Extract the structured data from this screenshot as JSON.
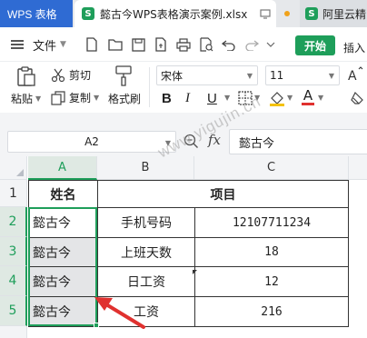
{
  "titlebar": {
    "app_tab": "WPS 表格",
    "doc_tab": "懿古今WPS表格演示案例.xlsx",
    "doc_tab_icon": "S",
    "second_tab": "阿里云精",
    "second_tab_icon": "S"
  },
  "menubar": {
    "file_label": "文件",
    "start_label": "开始",
    "insert_label": "插入"
  },
  "ribbon": {
    "paste_label": "粘贴",
    "cut_label": "剪切",
    "copy_label": "复制",
    "format_painter_label": "格式刷",
    "font_name": "宋体",
    "font_size": "11",
    "bold": "B",
    "italic": "I",
    "underline": "U",
    "font_color_letter": "A"
  },
  "formula_bar": {
    "name_box": "A2",
    "fx": "fx",
    "value": "懿古今"
  },
  "watermark": "www.yigujin.cn",
  "sheet": {
    "columns": [
      "A",
      "B",
      "C"
    ],
    "rows": [
      "1",
      "2",
      "3",
      "4",
      "5"
    ],
    "header": {
      "a": "姓名",
      "bc": "项目"
    },
    "data": [
      {
        "a": "懿古今",
        "b": "手机号码",
        "c": "12107711234"
      },
      {
        "a": "懿古今",
        "b": "上班天数",
        "c": "18"
      },
      {
        "a": "懿古今",
        "b": "日工资",
        "c": "12"
      },
      {
        "a": "懿古今",
        "b": "工资",
        "c": "216"
      }
    ]
  },
  "colors": {
    "accent": "#1e9e5a",
    "wps_blue": "#2f6bd3",
    "arrow": "#e0312f"
  }
}
